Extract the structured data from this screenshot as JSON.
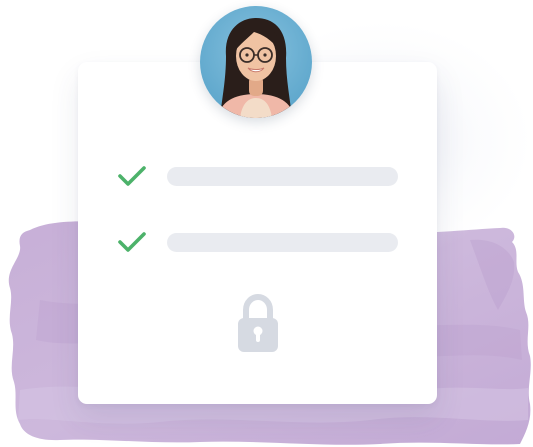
{
  "illustration": {
    "brush_color": "#c9b2d8",
    "card_color": "#ffffff",
    "avatar_background": "#6fb2d4",
    "check_color": "#4cb26a",
    "placeholder_bar_color": "#e9ebf0",
    "lock_color": "#d6dae2"
  },
  "checklist": {
    "items": [
      {
        "checked": true,
        "icon": "check-icon",
        "text": ""
      },
      {
        "checked": true,
        "icon": "check-icon",
        "text": ""
      }
    ]
  },
  "lock": {
    "icon": "padlock-icon",
    "locked": true
  },
  "avatar": {
    "icon": "user-avatar-photo"
  }
}
